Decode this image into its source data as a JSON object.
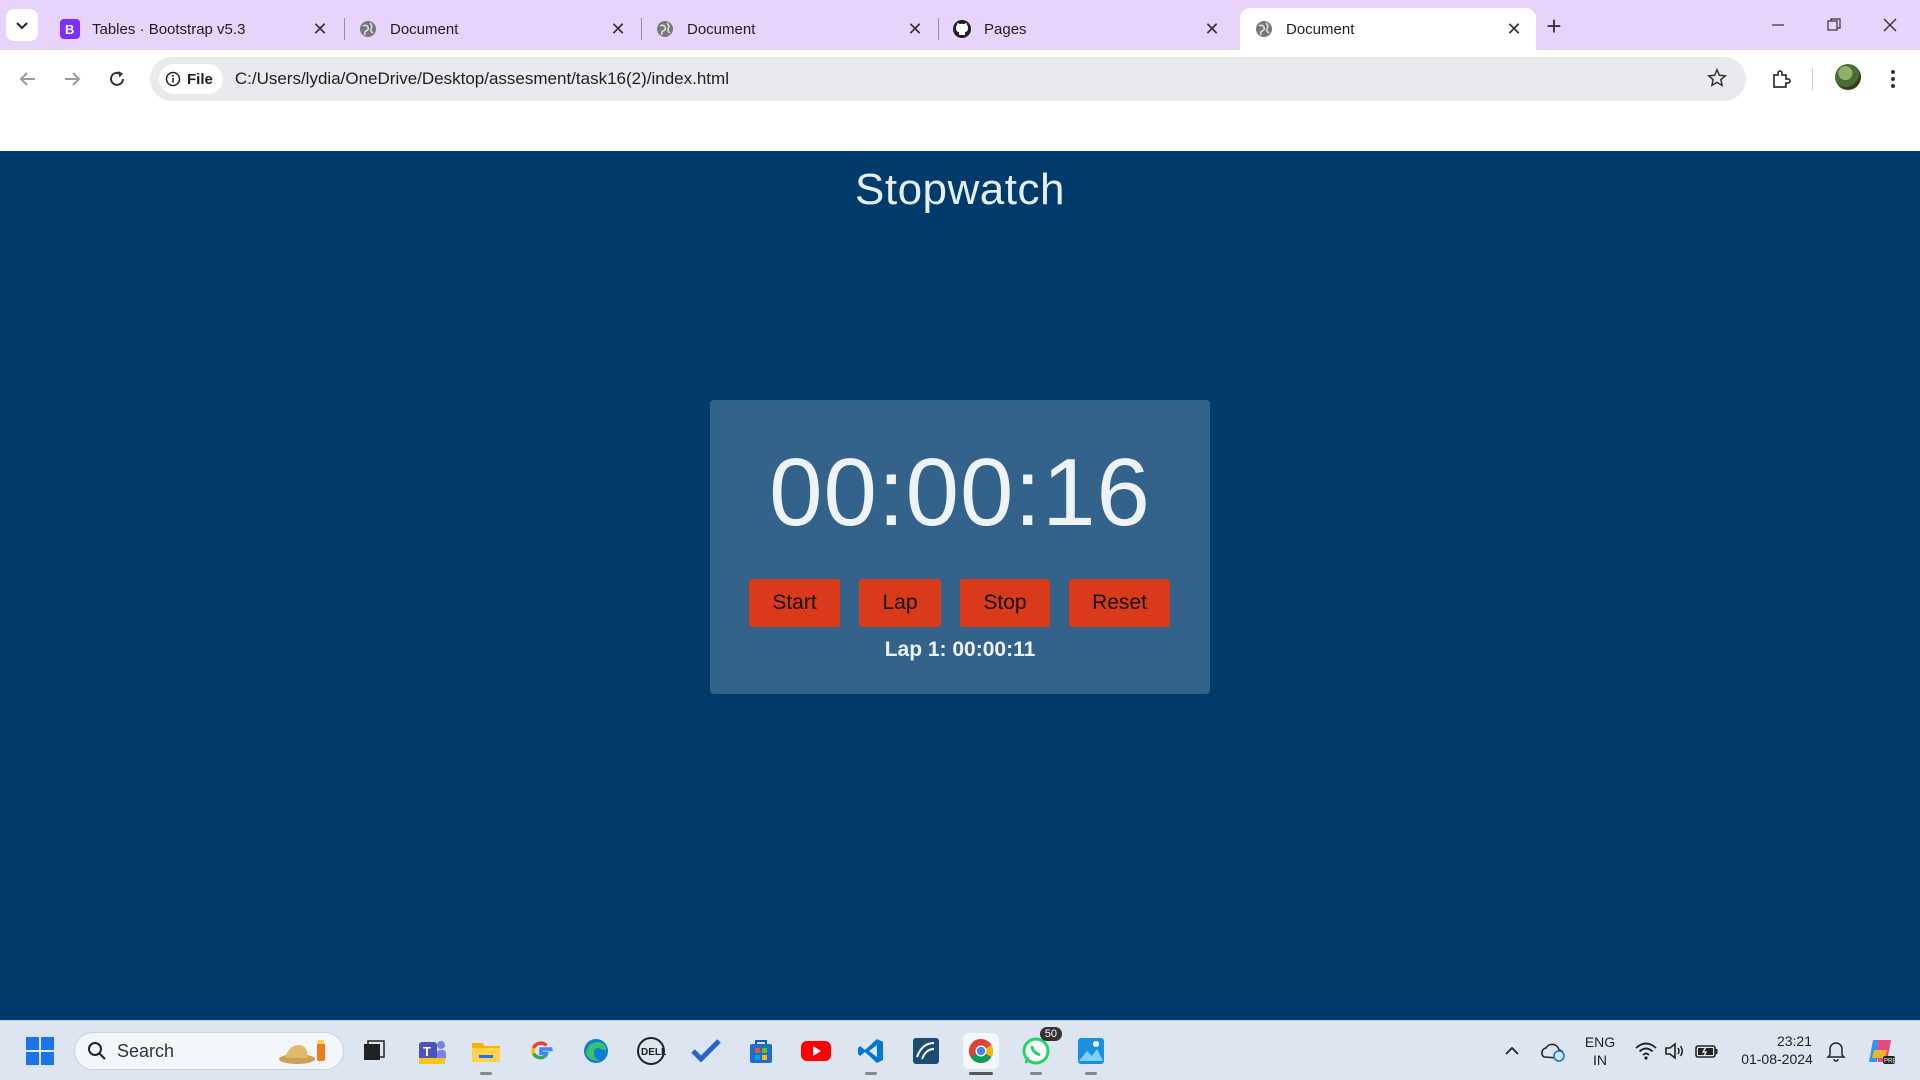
{
  "browser": {
    "tabs": [
      {
        "title": "Tables · Bootstrap v5.3",
        "icon": "bootstrap-icon",
        "active": false
      },
      {
        "title": "Document",
        "icon": "globe-icon",
        "active": false
      },
      {
        "title": "Document",
        "icon": "globe-icon",
        "active": false
      },
      {
        "title": "Pages",
        "icon": "github-icon",
        "active": false
      },
      {
        "title": "Document",
        "icon": "globe-icon",
        "active": true
      }
    ],
    "address": {
      "chip": "File",
      "url": "C:/Users/lydia/OneDrive/Desktop/assesment/task16(2)/index.html"
    }
  },
  "page": {
    "title": "Stopwatch",
    "timer": "00:00:16",
    "buttons": {
      "start": "Start",
      "lap": "Lap",
      "stop": "Stop",
      "reset": "Reset"
    },
    "laps": [
      "Lap 1: 00:00:11"
    ]
  },
  "taskbar": {
    "search_placeholder": "Search",
    "whatsapp_badge": "50",
    "lang_line1": "ENG",
    "lang_line2": "IN",
    "time": "23:21",
    "date": "01-08-2024"
  },
  "colors": {
    "tabstrip": "#e8d3fa",
    "page_bg": "#003b6b",
    "card_bg": "#33628b",
    "button_bg": "#d83a1a"
  }
}
